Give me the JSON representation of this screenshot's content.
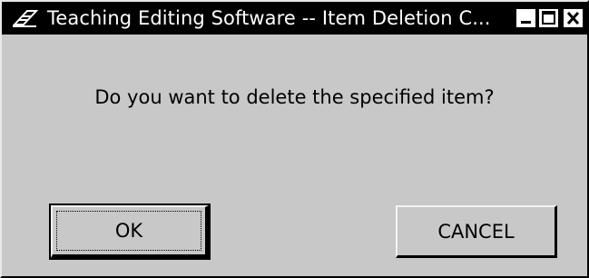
{
  "window": {
    "title": "Teaching Editing Software -- Item Deletion C...",
    "app_icon": "pencil-eraser-icon",
    "controls": [
      "minimize-icon",
      "maximize-icon",
      "close-icon"
    ]
  },
  "dialog": {
    "message": "Do you want to delete the specified item?",
    "ok_label": "OK",
    "cancel_label": "CANCEL"
  },
  "colors": {
    "titlebar": "#000000",
    "title_text": "#ffffff",
    "face": "#c8c8c8"
  }
}
